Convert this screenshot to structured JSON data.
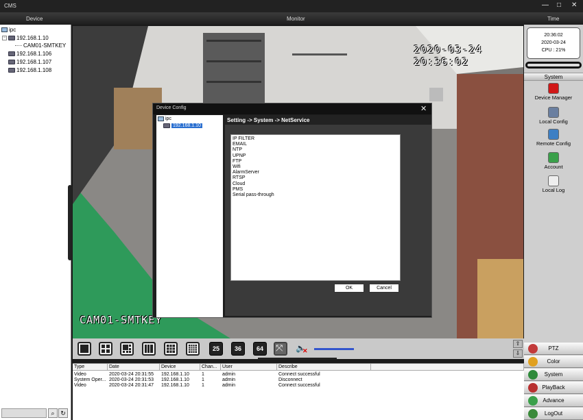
{
  "app": {
    "title": "CMS"
  },
  "headers": {
    "device": "Device",
    "monitor": "Monitor",
    "time": "Time"
  },
  "device_tree": {
    "root": "ipc",
    "items": [
      {
        "label": "192.168.1.10",
        "expanded": true
      },
      {
        "label": "CAM01-SMTKEY",
        "child": true
      },
      {
        "label": "192.168.1.106"
      },
      {
        "label": "192.168.1.107"
      },
      {
        "label": "192.168.1.108"
      }
    ]
  },
  "video": {
    "timestamp": "2020-03-24 20:36:02",
    "channel_name": "CAM01-SMTKEY"
  },
  "dialog": {
    "title": "Device Config",
    "close": "✕",
    "tree_root": "ipc",
    "tree_item": "192.168.1.10",
    "breadcrumb": "Setting -> System -> NetService",
    "services": [
      "IP FILTER",
      "EMAIL",
      "NTP",
      "UPNP",
      "FTP",
      "Wifi",
      "AlarmServer",
      "RTSP",
      "Cloud",
      "PMS",
      "Serial pass-through"
    ],
    "ok": "OK",
    "cancel": "Cancel"
  },
  "clock": {
    "time": "20:36:02",
    "date": "2020-03-24",
    "cpu": "CPU : 21%"
  },
  "system": {
    "header": "System",
    "buttons": [
      {
        "label": "Device Manager",
        "icon": "device-manager-icon",
        "color": "#d01818"
      },
      {
        "label": "Local Config",
        "icon": "local-config-icon",
        "color": "#6a7fa0"
      },
      {
        "label": "Remote Config",
        "icon": "remote-config-icon",
        "color": "#3d7fc4"
      },
      {
        "label": "Account",
        "icon": "account-icon",
        "color": "#3aa04a"
      },
      {
        "label": "Local Log",
        "icon": "local-log-icon",
        "color": "#eeeeee"
      }
    ]
  },
  "nav": [
    {
      "label": "PTZ",
      "icon": "ptz-icon",
      "color": "#c23a3a"
    },
    {
      "label": "Color",
      "icon": "color-icon",
      "color": "#e0a020"
    },
    {
      "label": "System",
      "icon": "system-icon",
      "color": "#2e8a3a"
    },
    {
      "label": "PlayBack",
      "icon": "playback-icon",
      "color": "#b83030"
    },
    {
      "label": "Advance",
      "icon": "advance-icon",
      "color": "#3aa04a"
    },
    {
      "label": "LogOut",
      "icon": "logout-icon",
      "color": "#3a8a3a"
    }
  ],
  "splits": {
    "n25": "25",
    "n36": "36",
    "n64": "64"
  },
  "log": {
    "columns": [
      "Type",
      "Date",
      "Device",
      "Chan...",
      "User",
      "Describe"
    ],
    "rows": [
      [
        "Video",
        "2020-03-24 20:31:55",
        "192.168.1.10",
        "1",
        "admin",
        "Connect successful"
      ],
      [
        "System Oper...",
        "2020-03-24 20:31:53",
        "192.168.1.10",
        "1",
        "admin",
        "Disconnect"
      ],
      [
        "Video",
        "2020-03-24 20:31:47",
        "192.168.1.10",
        "1",
        "admin",
        "Connect successful"
      ]
    ]
  }
}
